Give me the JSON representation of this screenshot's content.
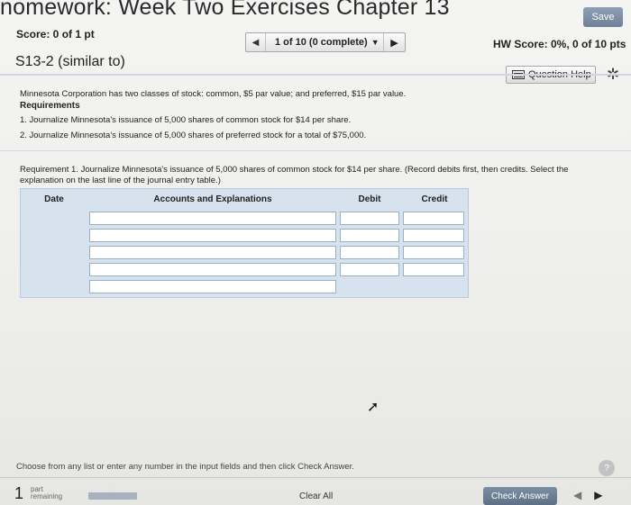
{
  "header": {
    "title": "nomework: Week Two Exercises Chapter 13",
    "save_label": "Save",
    "score": "Score: 0 of 1 pt",
    "nav_text": "1 of 10 (0 complete)",
    "hw_score": "HW Score: 0%, 0 of 10 pts",
    "problem_id": "S13-2 (similar to)",
    "question_help_label": "Question Help"
  },
  "problem": {
    "statement": "Minnesota Corporation has two classes of stock: common, $5 par value; and preferred, $15 par value.",
    "requirements_heading": "Requirements",
    "requirements": [
      "1. Journalize Minnesota's issuance of 5,000 shares of common stock for $14 per share.",
      "2. Journalize Minnesota's issuance of 5,000 shares of preferred stock for a total of $75,000."
    ],
    "instruction": "Requirement 1. Journalize Minnesota's issuance of 5,000 shares of common stock for $14 per share. (Record debits first, then credits. Select the explanation on the last line of the journal entry table.)"
  },
  "journal_table": {
    "columns": [
      "Date",
      "Accounts and Explanations",
      "Debit",
      "Credit"
    ],
    "rows": [
      {
        "date": "",
        "account": "",
        "debit": "",
        "credit": ""
      },
      {
        "date": "",
        "account": "",
        "debit": "",
        "credit": ""
      },
      {
        "date": "",
        "account": "",
        "debit": "",
        "credit": ""
      },
      {
        "date": "",
        "account": "",
        "debit": "",
        "credit": ""
      },
      {
        "date": "",
        "account": "",
        "debit": "",
        "credit": ""
      }
    ]
  },
  "footer": {
    "message": "Choose from any list or enter any number in the input fields and then click Check Answer.",
    "help_label": "?",
    "parts_count": "1",
    "parts_label_1": "part",
    "parts_label_2": "remaining",
    "clear_all_label": "Clear All",
    "check_answer_label": "Check Answer"
  },
  "icons": {
    "prev": "triangle-left-icon",
    "next": "triangle-right-icon",
    "dropdown": "caret-down-icon",
    "settings": "gear-icon",
    "question_help": "list-icon",
    "cursor": "mouse-pointer-icon"
  }
}
